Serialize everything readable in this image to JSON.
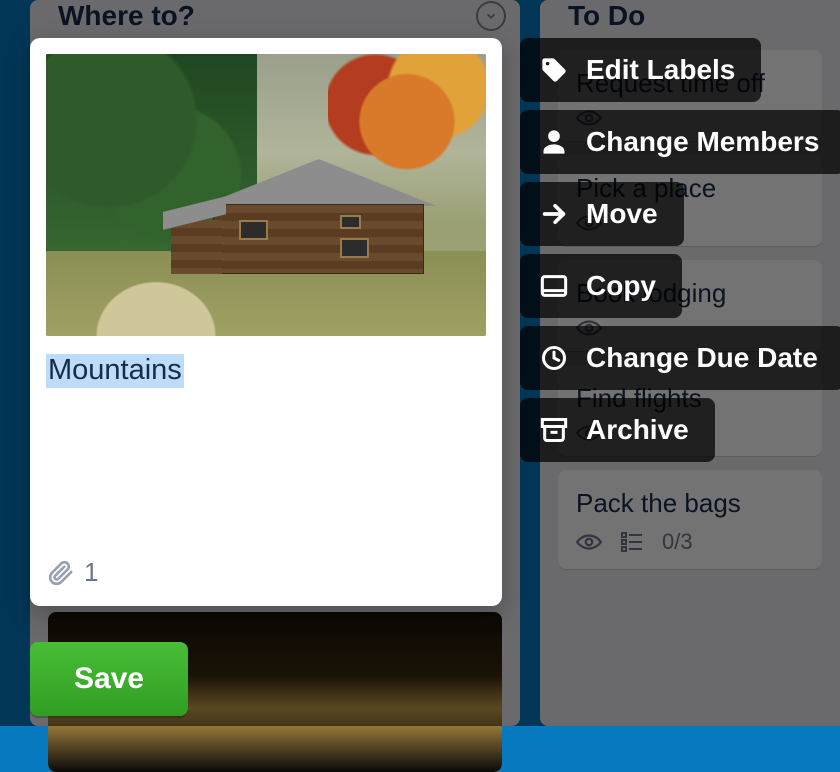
{
  "lists": {
    "left": {
      "title": "Where to?"
    },
    "right": {
      "title": "To Do",
      "cards": [
        {
          "title": "Request time off"
        },
        {
          "title": "Pick a place"
        },
        {
          "title": "Book lodging"
        },
        {
          "title": "Find flights"
        },
        {
          "title": "Pack the bags",
          "checklist": "0/3"
        }
      ]
    }
  },
  "quick_edit": {
    "card_title": "Mountains",
    "attachment_count": "1",
    "save_label": "Save"
  },
  "actions": {
    "edit_labels": "Edit Labels",
    "change_members": "Change Members",
    "move": "Move",
    "copy": "Copy",
    "change_due_date": "Change Due Date",
    "archive": "Archive"
  }
}
